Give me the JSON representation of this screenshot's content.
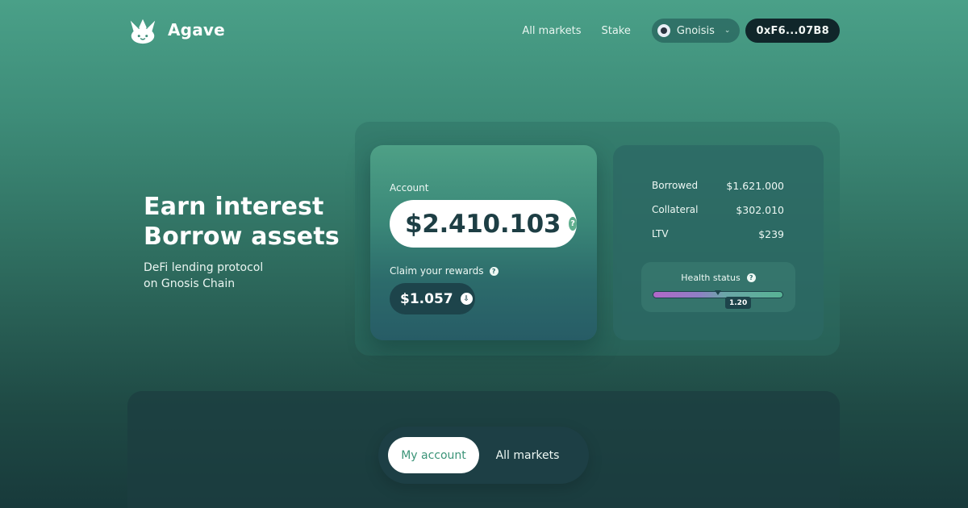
{
  "header": {
    "brand": "Agave",
    "nav": [
      "All markets",
      "Stake"
    ],
    "network": "Gnoisis",
    "wallet": "0xF6...07B8"
  },
  "hero": {
    "line1": "Earn interest",
    "line2": "Borrow assets",
    "sub1": "DeFi lending protocol",
    "sub2": "on Gnosis Chain"
  },
  "account": {
    "label": "Account",
    "balance": "$2.410.103",
    "help": "?",
    "rewards_label": "Claim your rewards",
    "rewards_value": "$1.057"
  },
  "stats": {
    "rows": [
      {
        "label": "Borrowed",
        "value": "$1.621.000"
      },
      {
        "label": "Collateral",
        "value": "$302.010"
      },
      {
        "label": "LTV",
        "value": "$239"
      }
    ],
    "health_label": "Health status",
    "health_value": "1.20",
    "health_fraction": 0.5
  },
  "tabs": [
    "My account",
    "All markets"
  ],
  "colors": {
    "accent": "#3b9478",
    "dark": "#1d444b",
    "wallet_bg": "#10262a"
  }
}
